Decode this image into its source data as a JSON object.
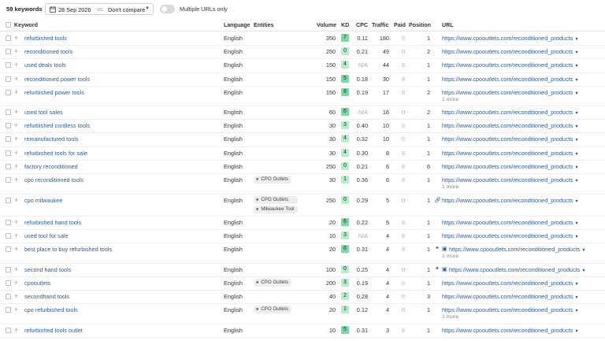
{
  "toolbar": {
    "keyword_count": "59 keywords",
    "date": "28 Sep 2026",
    "vs_label": "vs.",
    "compare": "Don't compare",
    "multi_urls_label": "Multiple URLs only"
  },
  "columns": {
    "keyword": "Keyword",
    "language": "Language",
    "entities": "Entities",
    "volume": "Volume",
    "kd": "KD",
    "cpc": "CPC",
    "traffic": "Traffic",
    "paid": "Paid",
    "position": "Position",
    "url": "URL"
  },
  "colors": {
    "kd_green": "#7fd7a6",
    "kd_light": "#b7eccd",
    "link": "#2e5b9a"
  },
  "rows": [
    {
      "keyword": "refurbished tools",
      "language": "English",
      "entities": [],
      "volume": "350",
      "kd": "7",
      "cpc": "0.11",
      "traffic": "180",
      "paid": "0",
      "position": "1",
      "features": "",
      "url": "https://www.cpooutlets.com/reconditioned_products",
      "more": ""
    },
    {
      "keyword": "reconditioned tools",
      "language": "English",
      "entities": [],
      "volume": "250",
      "kd": "0",
      "cpc": "0.21",
      "traffic": "49",
      "paid": "0",
      "position": "2",
      "features": "",
      "url": "https://www.cpooutlets.com/reconditioned_products",
      "more": ""
    },
    {
      "keyword": "used deals tools",
      "language": "English",
      "entities": [],
      "volume": "150",
      "kd": "4",
      "cpc": "N/A",
      "traffic": "44",
      "paid": "0",
      "position": "1",
      "features": "",
      "url": "https://www.cpooutlets.com/reconditioned_products",
      "more": ""
    },
    {
      "keyword": "reconditioned power tools",
      "language": "English",
      "entities": [],
      "volume": "150",
      "kd": "5",
      "cpc": "0.18",
      "traffic": "30",
      "paid": "0",
      "position": "1",
      "features": "",
      "url": "https://www.cpooutlets.com/reconditioned_products",
      "more": ""
    },
    {
      "keyword": "refurbished power tools",
      "language": "English",
      "entities": [],
      "volume": "150",
      "kd": "8",
      "cpc": "0.19",
      "traffic": "17",
      "paid": "0",
      "position": "2",
      "features": "",
      "url": "https://www.cpooutlets.com/reconditioned_products",
      "more": "1 more"
    },
    {
      "keyword": "used tool sales",
      "language": "English",
      "entities": [],
      "volume": "60",
      "kd": "6",
      "cpc": "N/A",
      "traffic": "16",
      "paid": "0",
      "position": "2",
      "features": "",
      "url": "https://www.cpooutlets.com/reconditioned_products",
      "more": ""
    },
    {
      "keyword": "refurbished cordless tools",
      "language": "English",
      "entities": [],
      "volume": "30",
      "kd": "3",
      "cpc": "0.40",
      "traffic": "10",
      "paid": "0",
      "position": "1",
      "features": "",
      "url": "https://www.cpooutlets.com/reconditioned_products",
      "more": ""
    },
    {
      "keyword": "remanufactured tools",
      "language": "English",
      "entities": [],
      "volume": "30",
      "kd": "4",
      "cpc": "0.32",
      "traffic": "10",
      "paid": "0",
      "position": "1",
      "features": "",
      "url": "https://www.cpooutlets.com/reconditioned_products",
      "more": ""
    },
    {
      "keyword": "refurbished tools for sale",
      "language": "English",
      "entities": [],
      "volume": "30",
      "kd": "4",
      "cpc": "0.30",
      "traffic": "8",
      "paid": "0",
      "position": "1",
      "features": "",
      "url": "https://www.cpooutlets.com/reconditioned_products",
      "more": ""
    },
    {
      "keyword": "factory reconditioned",
      "language": "English",
      "entities": [],
      "volume": "250",
      "kd": "0",
      "cpc": "0.21",
      "traffic": "6",
      "paid": "0",
      "position": "6",
      "features": "",
      "url": "https://www.cpooutlets.com/reconditioned_products",
      "more": ""
    },
    {
      "keyword": "cpo reconditioned tools",
      "language": "English",
      "entities": [
        "CPO Outlets"
      ],
      "volume": "30",
      "kd": "1",
      "cpc": "0.36",
      "traffic": "6",
      "paid": "0",
      "position": "1",
      "features": "",
      "url": "https://www.cpooutlets.com/reconditioned_products",
      "more": "1 more"
    },
    {
      "keyword": "cpo milwaukee",
      "language": "English",
      "entities": [
        "CPO Outlets",
        "Milwaukee Tool"
      ],
      "volume": "250",
      "kd": "0",
      "cpc": "0.29",
      "traffic": "5",
      "paid": "0",
      "position": "1",
      "features": "link-icon",
      "url": "https://www.cpooutlets.com/reconditioned_products",
      "more": ""
    },
    {
      "keyword": "refurbished hand tools",
      "language": "English",
      "entities": [],
      "volume": "20",
      "kd": "6",
      "cpc": "0.22",
      "traffic": "5",
      "paid": "0",
      "position": "1",
      "features": "",
      "url": "https://www.cpooutlets.com/reconditioned_products",
      "more": ""
    },
    {
      "keyword": "used tool for sale",
      "language": "English",
      "entities": [],
      "volume": "10",
      "kd": "3",
      "cpc": "N/A",
      "traffic": "4",
      "paid": "0",
      "position": "1",
      "features": "",
      "url": "https://www.cpooutlets.com/reconditioned_products",
      "more": ""
    },
    {
      "keyword": "best place to buy refurbished tools",
      "language": "English",
      "entities": [],
      "volume": "20",
      "kd": "6",
      "cpc": "0.31",
      "traffic": "4",
      "paid": "0",
      "position": "1",
      "features": "sitelinks-image-icons",
      "url": "https://www.cpooutlets.com/reconditioned_products",
      "more": "1 more"
    },
    {
      "keyword": "second hand tools",
      "language": "English",
      "entities": [],
      "volume": "100",
      "kd": "0",
      "cpc": "0.25",
      "traffic": "4",
      "paid": "0",
      "position": "1",
      "features": "sitelinks-image-icons",
      "url": "https://www.cpooutlets.com/reconditioned_products",
      "more": ""
    },
    {
      "keyword": "cpooutlets",
      "language": "English",
      "entities": [
        "CPO Outlets"
      ],
      "volume": "200",
      "kd": "3",
      "cpc": "0.19",
      "traffic": "4",
      "paid": "0",
      "position": "1",
      "features": "",
      "url": "https://www.cpooutlets.com/reconditioned_products",
      "more": ""
    },
    {
      "keyword": "secondhand tools",
      "language": "English",
      "entities": [],
      "volume": "40",
      "kd": "2",
      "cpc": "0.28",
      "traffic": "4",
      "paid": "0",
      "position": "3",
      "features": "",
      "url": "https://www.cpooutlets.com/reconditioned_products",
      "more": ""
    },
    {
      "keyword": "cpo refurbished tools",
      "language": "English",
      "entities": [
        "CPO Outlets"
      ],
      "volume": "20",
      "kd": "1",
      "cpc": "0.12",
      "traffic": "4",
      "paid": "0",
      "position": "1",
      "features": "",
      "url": "https://www.cpooutlets.com/reconditioned_products",
      "more": "1 more"
    },
    {
      "keyword": "refurbished tools outlet",
      "language": "English",
      "entities": [],
      "volume": "10",
      "kd": "5",
      "cpc": "0.31",
      "traffic": "3",
      "paid": "0",
      "position": "1",
      "features": "",
      "url": "https://www.cpooutlets.com/reconditioned_products",
      "more": ""
    }
  ]
}
